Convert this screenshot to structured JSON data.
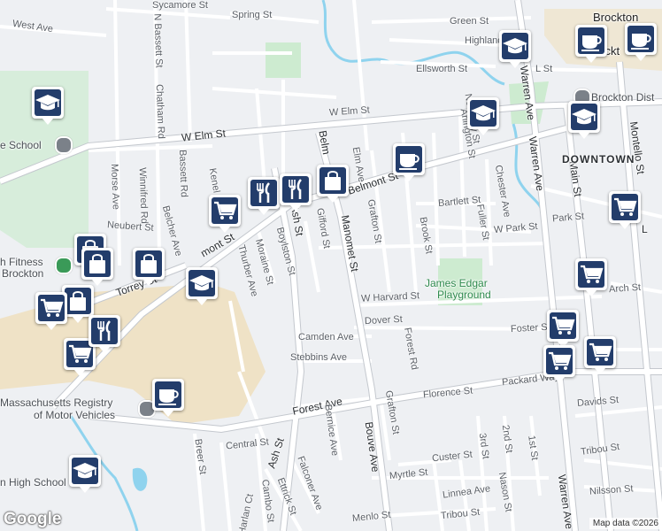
{
  "map": {
    "attribution": "Map data ©2026",
    "logo": "Google",
    "colors": {
      "background": "#eef0f3",
      "campus": "#efe2c6",
      "park": "#cdebd0",
      "water": "#8fd3ee",
      "road": "#ffffff",
      "road_edge": "#c4c8ce",
      "marker": "#233d6b"
    },
    "streets": {
      "sycamore": "Sycamore St",
      "spring": "Spring St",
      "n_bassett": "N Bassett St",
      "west_ave": "West Ave",
      "chatham": "Chatham Rd",
      "bassett": "Bassett Rd",
      "w_elm_left": "W Elm St",
      "w_elm_right": "W Elm St",
      "morse": "Morse Ave",
      "winnifred": "Winnifred Rd",
      "belcher": "Belcher Ave",
      "neubert": "Neubert St",
      "kenelm": "Kenel",
      "torrey": "Torrey St",
      "belmont_left": "mont St",
      "belmont_mid": "Belmont St",
      "belmont_vert": "Belm",
      "thurber": "Thurber Ave",
      "moraine": "Moraine St",
      "boylston": "Boylston St",
      "ash_upper": "Ash St",
      "gifford": "Gifford St",
      "manomet": "Manomet St",
      "elm_ave": "Elm Ave",
      "grafton_upper": "Grafton St",
      "brook": "Brook St",
      "bartlett": "Bartlett St",
      "arlington": "Arlington St",
      "newbury": "Newbury St",
      "chester": "Chester Ave",
      "fuller": "Fuller St",
      "w_park": "W Park St",
      "park": "Park St",
      "green": "Green St",
      "highland": "Highland",
      "ellsworth": "Ellsworth St",
      "l_st": "L St",
      "warren_upper": "Warren Ave",
      "warren_lower": "Warren Ave",
      "main": "Main St",
      "montello": "Montello St",
      "w_harvard": "W Harvard St",
      "arch": "Arch St",
      "dover": "Dover St",
      "foster": "Foster S",
      "forest_rd": "Forest Rd",
      "camden": "Camden Ave",
      "stebbins": "Stebbins Ave",
      "forest_ave": "Forest Ave",
      "florence": "Florence St",
      "packard": "Packard Way",
      "davids": "Davids St",
      "central": "Central St",
      "ash_lower": "Ash St",
      "bernice": "Bernice Ave",
      "bouve": "Bouve Ave",
      "grafton_lower": "Grafton St",
      "myrtle": "Myrtle St",
      "custer": "Custer St",
      "third": "3rd St",
      "second": "2nd St",
      "first": "1st St",
      "tribou_right": "Tribou St",
      "breer": "Breer St",
      "falconer": "Falconer Ave",
      "ettrick": "Ettrick St",
      "cambo": "Cambo St",
      "harlan": "Harlan Ct",
      "linnea": "Linnea Ave",
      "nason": "Nason St",
      "nilsson": "Nilsson St",
      "menlo": "Menlo St",
      "tribou_left": "Tribou St",
      "l_right": "L"
    },
    "places": {
      "school_left": "e School",
      "fitness": "h Fitness",
      "brockton_small": "Brockton",
      "registry_line1": "Massachusetts Registry",
      "registry_line2": "of Motor Vehicles",
      "high_school": "n High School",
      "brockton_city": "Brockton",
      "brockton_ro": "rockt",
      "brockton_dist": "Brockton Dist",
      "downtown": "DOWNTOWN",
      "playground_line1": "James Edgar",
      "playground_line2": "Playground"
    },
    "markers": [
      {
        "icon": "graduation-cap-icon"
      },
      {
        "icon": "graduation-cap-icon"
      },
      {
        "icon": "graduation-cap-icon"
      },
      {
        "icon": "graduation-cap-icon"
      },
      {
        "icon": "graduation-cap-icon"
      },
      {
        "icon": "graduation-cap-icon"
      },
      {
        "icon": "coffee-cup-icon"
      },
      {
        "icon": "coffee-cup-icon"
      },
      {
        "icon": "coffee-cup-icon"
      },
      {
        "icon": "coffee-cup-icon"
      },
      {
        "icon": "shopping-bag-icon"
      },
      {
        "icon": "shopping-bag-icon"
      },
      {
        "icon": "shopping-bag-icon"
      },
      {
        "icon": "shopping-bag-icon"
      },
      {
        "icon": "shopping-bag-icon"
      },
      {
        "icon": "shopping-cart-icon"
      },
      {
        "icon": "shopping-cart-icon"
      },
      {
        "icon": "shopping-cart-icon"
      },
      {
        "icon": "shopping-cart-icon"
      },
      {
        "icon": "shopping-cart-icon"
      },
      {
        "icon": "shopping-cart-icon"
      },
      {
        "icon": "shopping-cart-icon"
      },
      {
        "icon": "shopping-cart-icon"
      },
      {
        "icon": "fork-knife-icon"
      },
      {
        "icon": "fork-knife-icon"
      },
      {
        "icon": "fork-knife-icon"
      }
    ]
  }
}
